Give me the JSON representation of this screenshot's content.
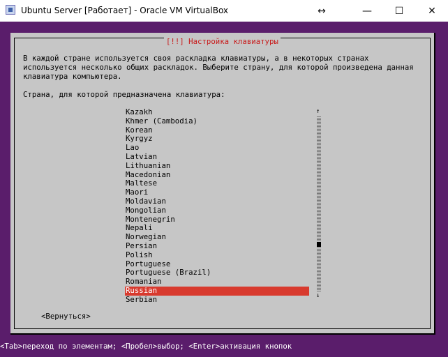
{
  "window": {
    "title": "Ubuntu Server [Работает] - Oracle VM VirtualBox",
    "controls": {
      "resize": "↔",
      "minimize": "—",
      "maximize": "☐",
      "close": "✕"
    }
  },
  "dialog": {
    "title": "[!!] Настройка клавиатуры",
    "description": "В каждой стране используется своя раскладка клавиатуры, а в некоторых странах\nиспользуется несколько общих раскладок. Выберите страну, для которой произведена данная\nклавиатура компьютера.",
    "country_label": "Страна, для которой предназначена клавиатура:",
    "items": [
      "Kazakh",
      "Khmer (Cambodia)",
      "Korean",
      "Kyrgyz",
      "Lao",
      "Latvian",
      "Lithuanian",
      "Macedonian",
      "Maltese",
      "Maori",
      "Moldavian",
      "Mongolian",
      "Montenegrin",
      "Nepali",
      "Norwegian",
      "Persian",
      "Polish",
      "Portuguese",
      "Portuguese (Brazil)",
      "Romanian",
      "Russian",
      "Serbian"
    ],
    "selected": "Russian",
    "scroll_up": "↑",
    "scroll_down": "↓",
    "back_button": "<Вернуться>"
  },
  "statusbar": {
    "text": "<Tab>переход по элементам; <Пробел>выбор; <Enter>активация кнопок"
  },
  "colors": {
    "background": "#5a1d6b",
    "dialog": "#c6c6c6",
    "selection": "#d83a2e",
    "title_text": "#c81a1a"
  },
  "icons": {
    "app": "virtualbox-icon"
  }
}
